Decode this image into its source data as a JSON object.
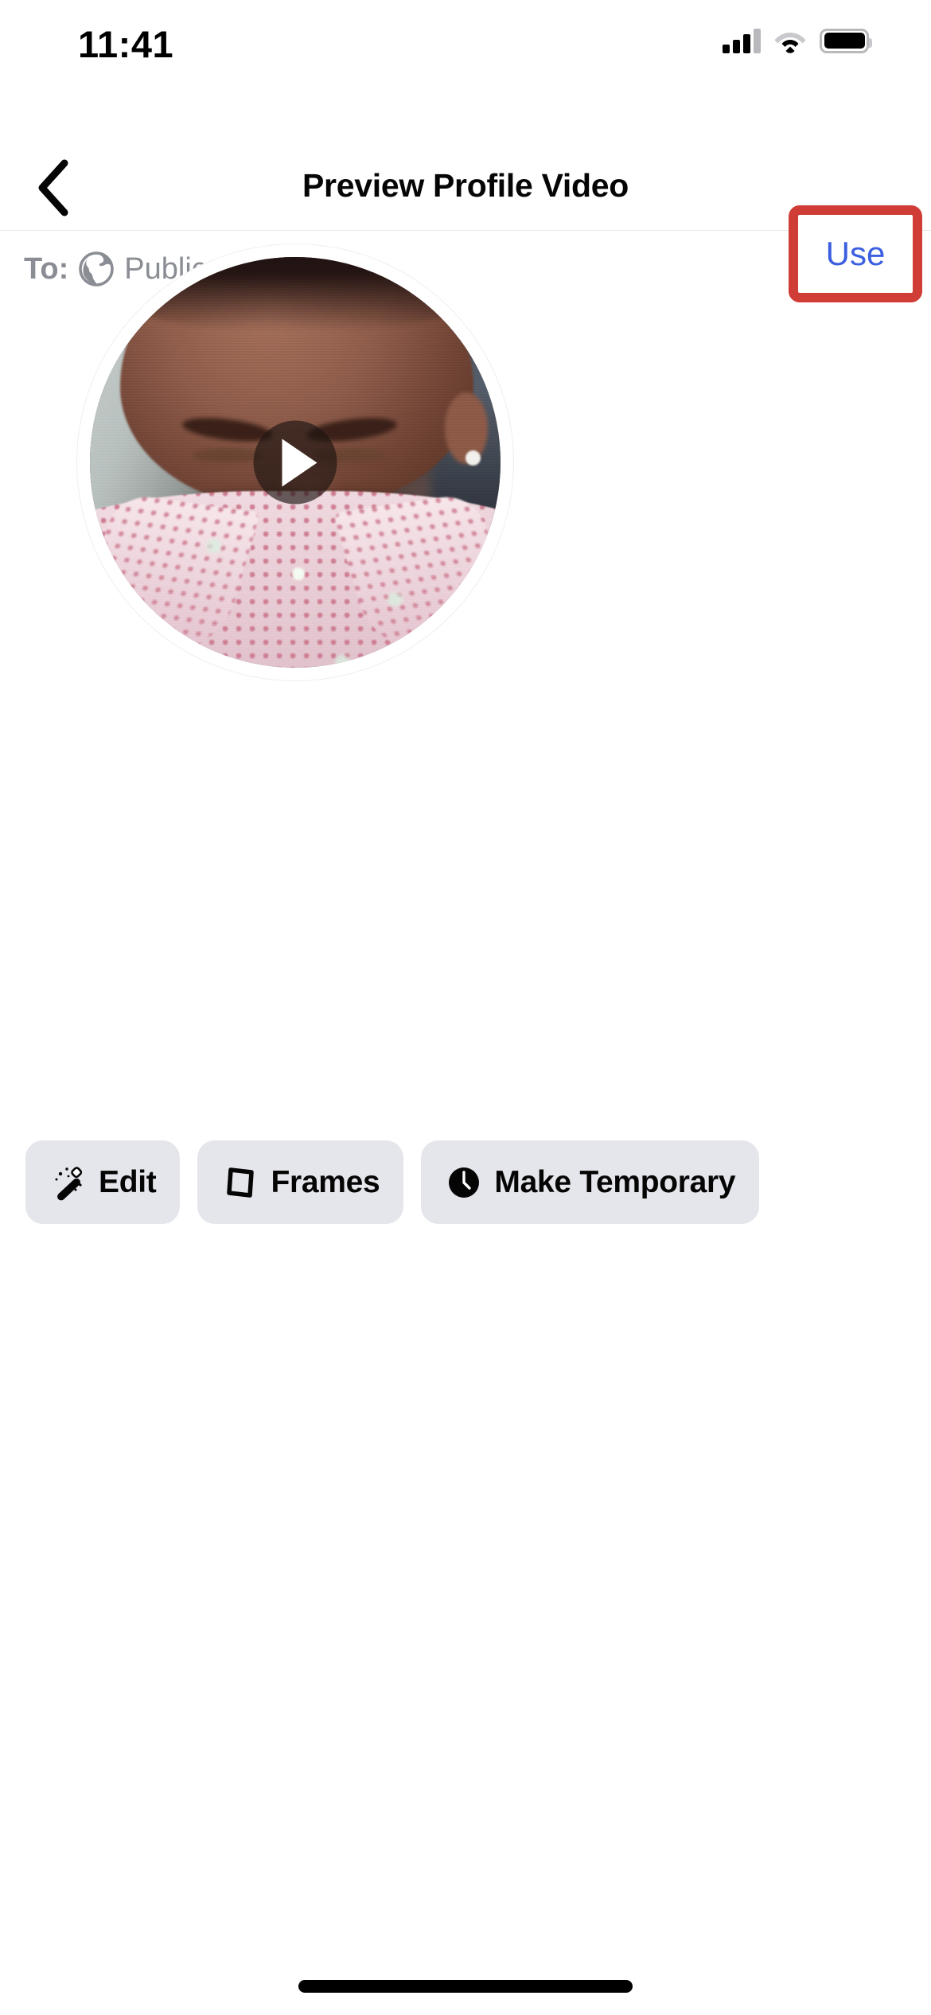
{
  "status_bar": {
    "time": "11:41",
    "signal_icon": "cellular-signal-icon",
    "wifi_icon": "wifi-icon",
    "battery_icon": "battery-full-icon"
  },
  "nav_bar": {
    "back_icon": "chevron-left-icon",
    "title": "Preview Profile Video",
    "use_label": "Use",
    "use_color": "#3b5fe0",
    "highlight_color": "#d03c36"
  },
  "audience": {
    "label": "To:",
    "globe_icon": "globe-icon",
    "value": "Public",
    "color": "#8a8d94"
  },
  "video": {
    "play_icon": "play-triangle-icon",
    "ring_color": "#ffffff"
  },
  "actions": [
    {
      "label": "Edit",
      "icon": "magic-wand-icon"
    },
    {
      "label": "Frames",
      "icon": "frame-icon"
    },
    {
      "label": "Make Temporary",
      "icon": "clock-icon"
    }
  ],
  "theme": {
    "background": "#ffffff",
    "button_background": "#e4e6eb",
    "text_primary": "#050505",
    "text_secondary": "#8a8d94"
  }
}
